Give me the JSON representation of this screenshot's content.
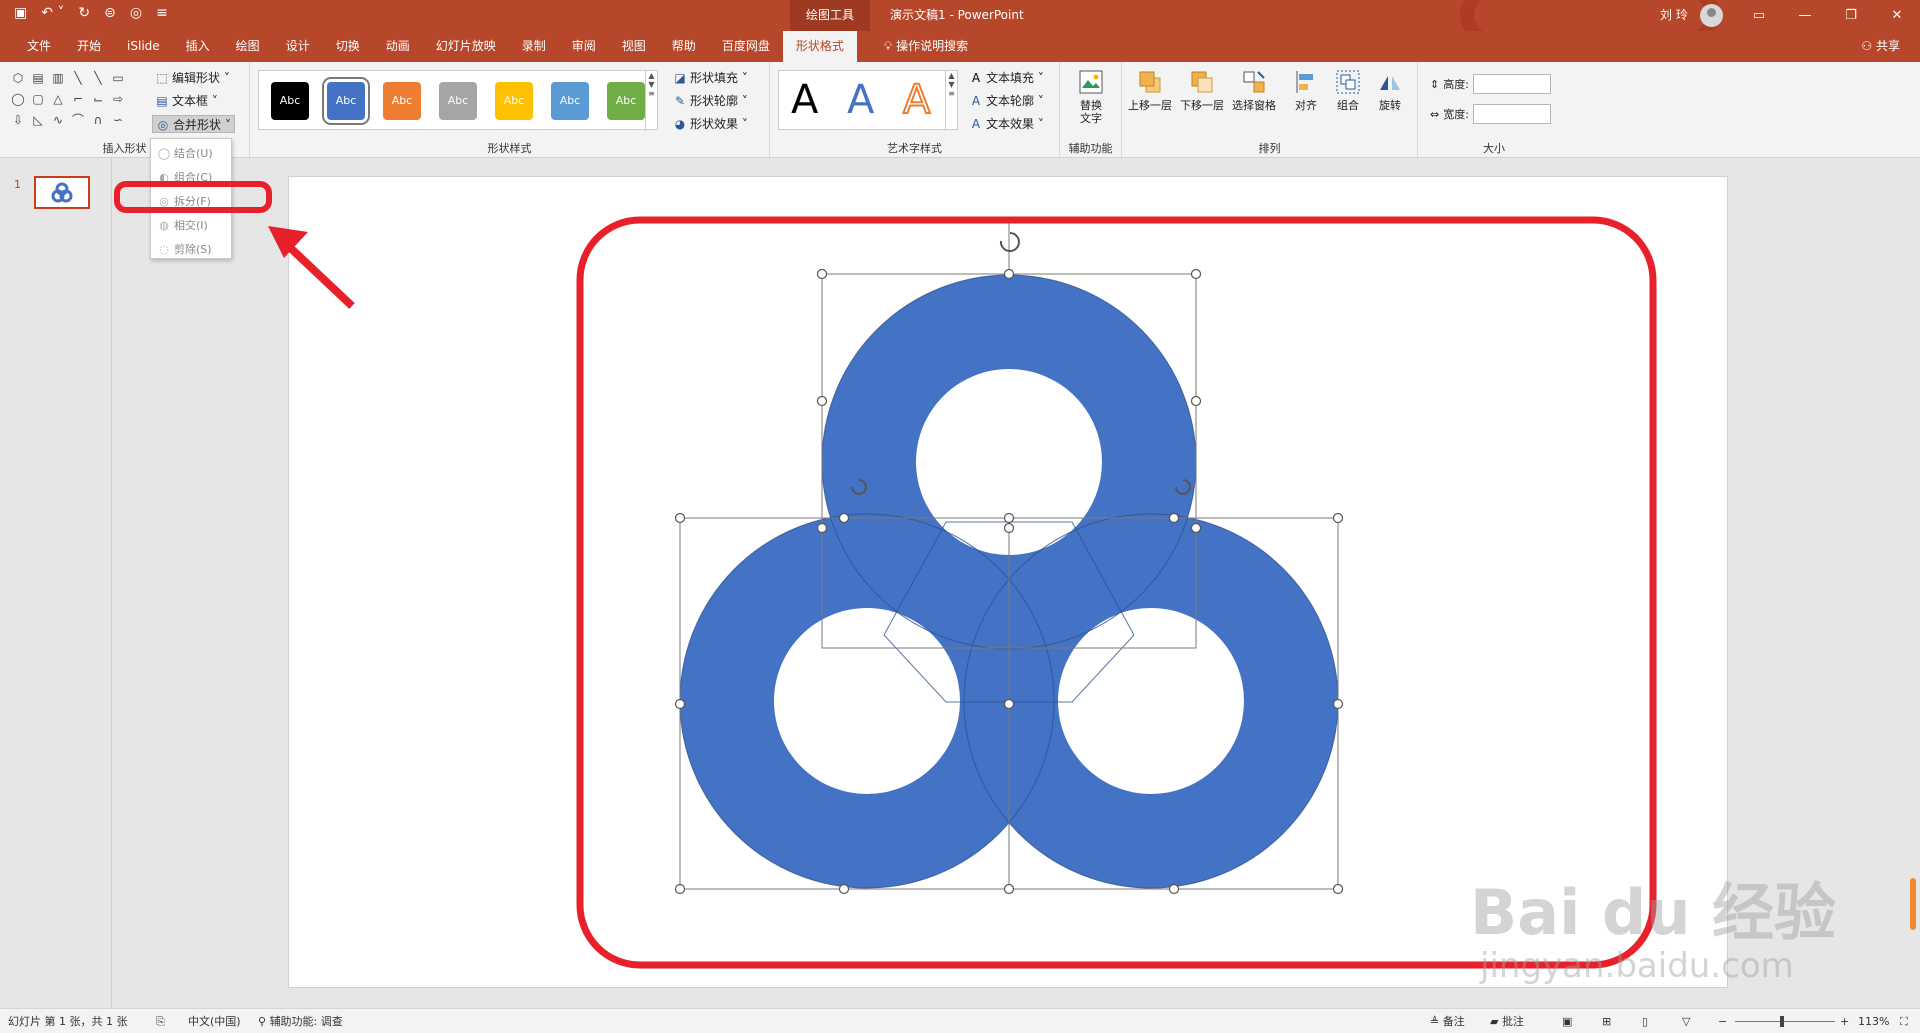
{
  "title_bar": {
    "context_tools": "绘图工具",
    "document_title": "演示文稿1  -  PowerPoint",
    "user_name": "刘 玲"
  },
  "tabs": [
    "文件",
    "开始",
    "iSlide",
    "插入",
    "绘图",
    "设计",
    "切换",
    "动画",
    "幻灯片放映",
    "录制",
    "审阅",
    "视图",
    "帮助",
    "百度网盘",
    "形状格式"
  ],
  "active_tab": "形状格式",
  "search_tab": "操作说明搜索",
  "share_label": "共享",
  "ribbon": {
    "insert_shapes": {
      "label": "插入形状",
      "edit_shape": "编辑形状",
      "textbox": "文本框",
      "merge_shapes": "合并形状"
    },
    "shape_styles": {
      "label": "形状样式",
      "swatch_text": "Abc",
      "swatches": [
        "#000000",
        "#4472c4",
        "#ed7d31",
        "#a5a5a5",
        "#ffc000",
        "#5b9bd5",
        "#70ad47"
      ],
      "fill": "形状填充",
      "outline": "形状轮廓",
      "effects": "形状效果"
    },
    "wordart": {
      "label": "艺术字样式",
      "letter": "A",
      "text_fill": "文本填充",
      "text_outline": "文本轮廓",
      "text_effects": "文本效果"
    },
    "accessibility": {
      "label": "辅助功能",
      "alt_text_line1": "替换",
      "alt_text_line2": "文字"
    },
    "arrange": {
      "label": "排列",
      "bring_forward": "上移一层",
      "send_backward": "下移一层",
      "selection_pane": "选择窗格",
      "align": "对齐",
      "group": "组合",
      "rotate": "旋转"
    },
    "size": {
      "label": "大小",
      "height": "高度:",
      "width": "宽度:"
    }
  },
  "merge_menu": {
    "items": [
      "结合(U)",
      "组合(C)",
      "拆分(F)",
      "相交(I)",
      "剪除(S)"
    ]
  },
  "slide_pane": {
    "slide_number": "1"
  },
  "watermark": {
    "line1": "Bai du 经验",
    "line2": "jingyan.baidu.com"
  },
  "status_bar": {
    "slide_info": "幻灯片 第 1 张，共 1 张",
    "language": "中文(中国)",
    "accessibility": "辅助功能: 调查",
    "notes": "备注",
    "comments": "批注",
    "zoom": "113%"
  },
  "colors": {
    "accent": "#b7472a",
    "shape_fill": "#4472c4",
    "annotation": "#e8202a"
  }
}
